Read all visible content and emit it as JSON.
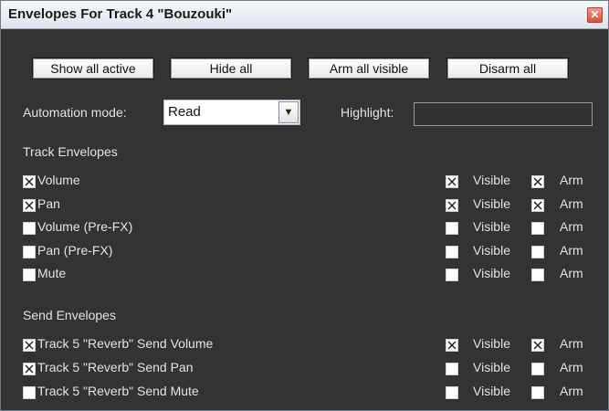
{
  "window": {
    "title": "Envelopes For Track 4 \"Bouzouki\""
  },
  "toolbar": {
    "show_all_active": "Show all active",
    "hide_all": "Hide all",
    "arm_all_visible": "Arm all visible",
    "disarm_all": "Disarm all"
  },
  "automation": {
    "label": "Automation mode:",
    "value": "Read"
  },
  "highlight": {
    "label": "Highlight:",
    "value": ""
  },
  "track_envelopes": {
    "heading": "Track Envelopes",
    "rows": [
      {
        "name": "Volume",
        "enabled": true,
        "visible": true,
        "arm": true
      },
      {
        "name": "Pan",
        "enabled": true,
        "visible": true,
        "arm": true
      },
      {
        "name": "Volume (Pre-FX)",
        "enabled": false,
        "visible": false,
        "arm": false
      },
      {
        "name": "Pan (Pre-FX)",
        "enabled": false,
        "visible": false,
        "arm": false
      },
      {
        "name": "Mute",
        "enabled": false,
        "visible": false,
        "arm": false
      }
    ]
  },
  "send_envelopes": {
    "heading": "Send Envelopes",
    "rows": [
      {
        "name": "Track 5 \"Reverb\" Send Volume",
        "enabled": true,
        "visible": true,
        "arm": true
      },
      {
        "name": "Track 5 \"Reverb\" Send Pan",
        "enabled": true,
        "visible": false,
        "arm": false
      },
      {
        "name": "Track 5 \"Reverb\" Send Mute",
        "enabled": false,
        "visible": false,
        "arm": false
      }
    ]
  },
  "column_labels": {
    "visible": "Visible",
    "arm": "Arm"
  },
  "icons": {
    "close": "close-icon",
    "dropdown": "chevron-down-icon",
    "check": "x-check-icon"
  },
  "colors": {
    "panel_bg": "#333333",
    "text": "#e3e3e3",
    "close_button": "#d9503c"
  }
}
